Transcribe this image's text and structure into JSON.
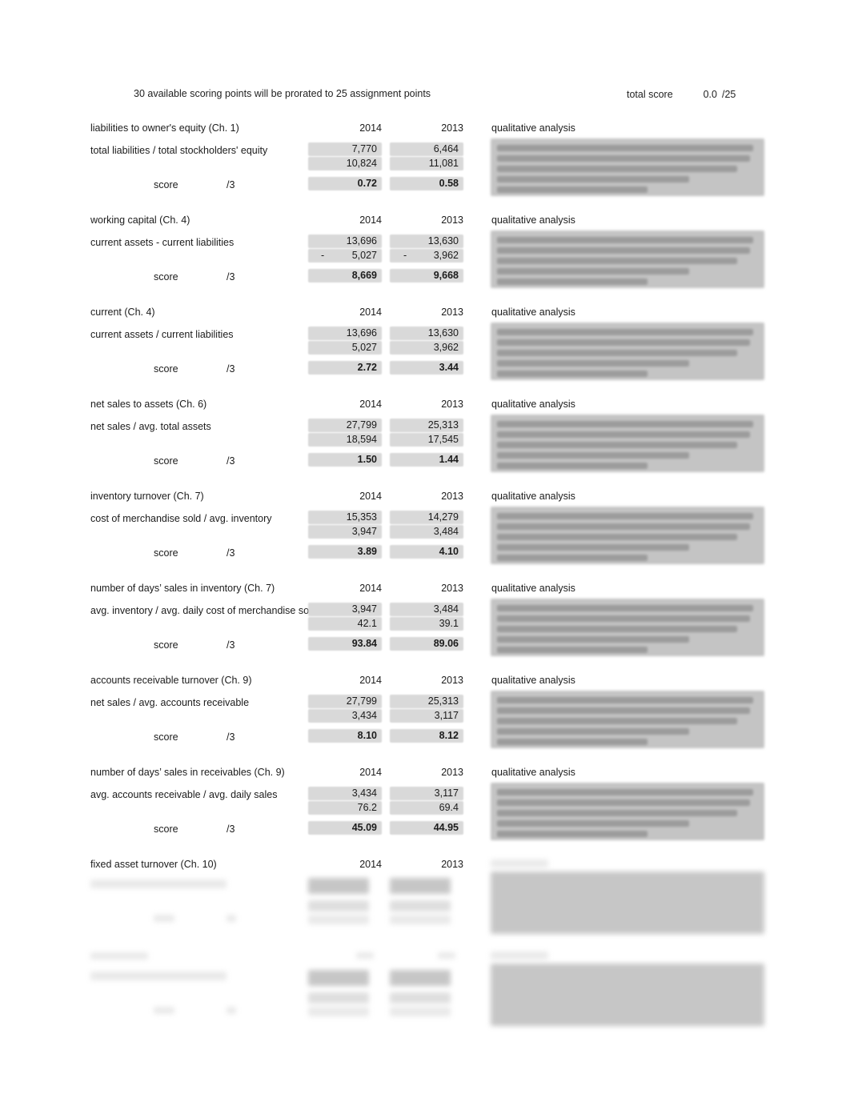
{
  "header": {
    "note": "30 available scoring points will be prorated to 25 assignment points",
    "total_score_label": "total score",
    "total_score_value": "0.0",
    "total_score_max": "/25"
  },
  "labels": {
    "score": "score",
    "score_max": "/3",
    "qualitative_analysis": "qualitative analysis",
    "minus": "-",
    "year_1": "2014",
    "year_2": "2013"
  },
  "blocks": [
    {
      "name": "liabilities to owner's equity (Ch. 1)",
      "formula": "total liabilities / total stockholders' equity",
      "year1": "2014",
      "year2": "2013",
      "c1_numerator": "7,770",
      "c1_denominator": "10,824",
      "c1_score": "0.72",
      "c2_numerator": "6,464",
      "c2_denominator": "11,081",
      "c2_score": "0.58",
      "subtract": false,
      "redacted": false
    },
    {
      "name": "working capital (Ch. 4)",
      "formula": "current assets - current liabilities",
      "year1": "2014",
      "year2": "2013",
      "c1_numerator": "13,696",
      "c1_denominator": "5,027",
      "c1_score": "8,669",
      "c2_numerator": "13,630",
      "c2_denominator": "3,962",
      "c2_score": "9,668",
      "subtract": true,
      "redacted": false
    },
    {
      "name": "current (Ch. 4)",
      "formula": "current assets / current liabilities",
      "year1": "2014",
      "year2": "2013",
      "c1_numerator": "13,696",
      "c1_denominator": "5,027",
      "c1_score": "2.72",
      "c2_numerator": "13,630",
      "c2_denominator": "3,962",
      "c2_score": "3.44",
      "subtract": false,
      "redacted": false
    },
    {
      "name": "net sales to assets (Ch. 6)",
      "formula": "net sales / avg. total assets",
      "year1": "2014",
      "year2": "2013",
      "c1_numerator": "27,799",
      "c1_denominator": "18,594",
      "c1_score": "1.50",
      "c2_numerator": "25,313",
      "c2_denominator": "17,545",
      "c2_score": "1.44",
      "subtract": false,
      "redacted": false
    },
    {
      "name": "inventory turnover (Ch. 7)",
      "formula": "cost of merchandise sold / avg. inventory",
      "year1": "2014",
      "year2": "2013",
      "c1_numerator": "15,353",
      "c1_denominator": "3,947",
      "c1_score": "3.89",
      "c2_numerator": "14,279",
      "c2_denominator": "3,484",
      "c2_score": "4.10",
      "subtract": false,
      "redacted": false
    },
    {
      "name": "number of days’ sales in inventory (Ch. 7)",
      "formula": "avg. inventory / avg. daily cost of merchandise sold",
      "year1": "2014",
      "year2": "2013",
      "c1_numerator": "3,947",
      "c1_denominator": "42.1",
      "c1_score": "93.84",
      "c2_numerator": "3,484",
      "c2_denominator": "39.1",
      "c2_score": "89.06",
      "subtract": false,
      "redacted": false
    },
    {
      "name": "accounts receivable turnover (Ch. 9)",
      "formula": "net sales / avg. accounts receivable",
      "year1": "2014",
      "year2": "2013",
      "c1_numerator": "27,799",
      "c1_denominator": "3,434",
      "c1_score": "8.10",
      "c2_numerator": "25,313",
      "c2_denominator": "3,117",
      "c2_score": "8.12",
      "subtract": false,
      "redacted": false
    },
    {
      "name": "number of days’ sales in receivables (Ch. 9)",
      "formula": "avg. accounts receivable / avg. daily sales",
      "year1": "2014",
      "year2": "2013",
      "c1_numerator": "3,434",
      "c1_denominator": "76.2",
      "c1_score": "45.09",
      "c2_numerator": "3,117",
      "c2_denominator": "69.4",
      "c2_score": "44.95",
      "subtract": false,
      "redacted": false
    },
    {
      "name": "fixed asset turnover (Ch. 10)",
      "formula": "",
      "year1": "2014",
      "year2": "2013",
      "c1_numerator": "",
      "c1_denominator": "",
      "c1_score": "",
      "c2_numerator": "",
      "c2_denominator": "",
      "c2_score": "",
      "subtract": false,
      "redacted": true
    },
    {
      "name": "",
      "formula": "",
      "year1": "",
      "year2": "",
      "c1_numerator": "",
      "c1_denominator": "",
      "c1_score": "",
      "c2_numerator": "",
      "c2_denominator": "",
      "c2_score": "",
      "subtract": false,
      "redacted": true
    }
  ]
}
